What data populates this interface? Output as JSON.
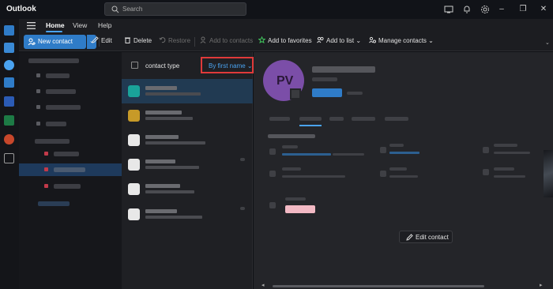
{
  "app": {
    "title": "Outlook"
  },
  "search": {
    "placeholder": "Search"
  },
  "menu": {
    "tabs": [
      "Home",
      "View",
      "Help"
    ],
    "active": "Home"
  },
  "toolbar": {
    "new_contact": "New contact",
    "edit": "Edit",
    "delete": "Delete",
    "restore": "Restore",
    "add_to_contacts": "Add to contacts",
    "add_to_favorites": "Add to favorites",
    "add_to_list": "Add to list",
    "manage_contacts": "Manage contacts"
  },
  "list": {
    "header_label": "contact type",
    "sort_label": "By first name",
    "avatar_colors": [
      "#1aa39a",
      "#c79a28",
      "#e8e8e8",
      "#e8e8e8",
      "#e8e8e8",
      "#e8e8e8"
    ]
  },
  "detail": {
    "initials": "PV",
    "edit_contact": "Edit contact"
  },
  "colors": {
    "accent": "#2f7cc8",
    "highlight_border": "#e03a3a",
    "avatar": "#7b4ea8"
  }
}
